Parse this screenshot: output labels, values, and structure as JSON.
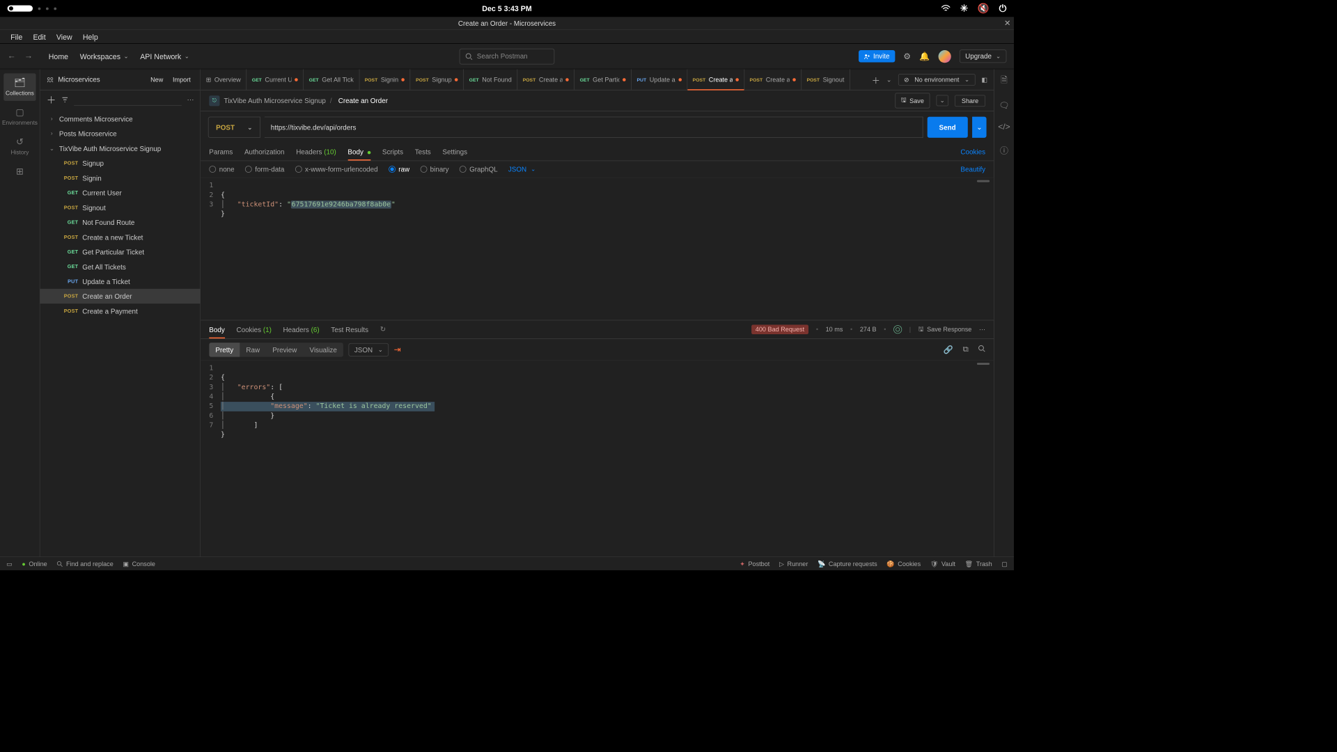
{
  "mac": {
    "clock": "Dec 5   3:43 PM"
  },
  "window": {
    "title": "Create an Order - Microservices"
  },
  "menu": {
    "file": "File",
    "edit": "Edit",
    "view": "View",
    "help": "Help"
  },
  "header": {
    "home": "Home",
    "workspaces": "Workspaces",
    "api_network": "API Network",
    "search_placeholder": "Search Postman",
    "invite": "Invite",
    "upgrade": "Upgrade"
  },
  "leftbar": {
    "collections": "Collections",
    "environments": "Environments",
    "history": "History"
  },
  "sidebar": {
    "title": "Microservices",
    "new": "New",
    "import": "Import",
    "folders": [
      {
        "name": "Comments Microservice",
        "open": false
      },
      {
        "name": "Posts Microservice",
        "open": false
      },
      {
        "name": "TixVibe Auth Microservice Signup",
        "open": true,
        "items": [
          {
            "method": "POST",
            "label": "Signup"
          },
          {
            "method": "POST",
            "label": "Signin"
          },
          {
            "method": "GET",
            "label": "Current User"
          },
          {
            "method": "POST",
            "label": "Signout"
          },
          {
            "method": "GET",
            "label": "Not Found Route"
          },
          {
            "method": "POST",
            "label": "Create a new Ticket"
          },
          {
            "method": "GET",
            "label": "Get Particular Ticket"
          },
          {
            "method": "GET",
            "label": "Get All Tickets"
          },
          {
            "method": "PUT",
            "label": "Update a Ticket"
          },
          {
            "method": "POST",
            "label": "Create an Order",
            "active": true
          },
          {
            "method": "POST",
            "label": "Create a Payment"
          }
        ]
      }
    ]
  },
  "tabs": [
    {
      "icon": "grid",
      "label": "Overview"
    },
    {
      "method": "GET",
      "label": "Current Us",
      "dirty": true
    },
    {
      "method": "GET",
      "label": "Get All Tick"
    },
    {
      "method": "POST",
      "label": "Signin",
      "dirty": true
    },
    {
      "method": "POST",
      "label": "Signup",
      "dirty": true
    },
    {
      "method": "GET",
      "label": "Not Found"
    },
    {
      "method": "POST",
      "label": "Create a",
      "dirty": true
    },
    {
      "method": "GET",
      "label": "Get Partic",
      "dirty": true
    },
    {
      "method": "PUT",
      "label": "Update a",
      "dirty": true
    },
    {
      "method": "POST",
      "label": "Create an",
      "dirty": true,
      "active": true
    },
    {
      "method": "POST",
      "label": "Create a",
      "dirty": true
    },
    {
      "method": "POST",
      "label": "Signout"
    }
  ],
  "env": {
    "label": "No environment"
  },
  "request": {
    "breadcrumb_workspace": "TixVibe Auth Microservice Signup",
    "title": "Create an Order",
    "save": "Save",
    "share": "Share",
    "method": "POST",
    "url": "https://tixvibe.dev/api/orders",
    "send": "Send"
  },
  "subtabs": {
    "params": "Params",
    "authorization": "Authorization",
    "headers_label": "Headers",
    "headers_count": "(10)",
    "body": "Body",
    "scripts": "Scripts",
    "tests": "Tests",
    "settings": "Settings",
    "cookies": "Cookies"
  },
  "bodytypes": {
    "none": "none",
    "formdata": "form-data",
    "xwww": "x-www-form-urlencoded",
    "raw": "raw",
    "binary": "binary",
    "graphql": "GraphQL",
    "json": "JSON",
    "beautify": "Beautify"
  },
  "body_code": {
    "l1": "{",
    "l2_key": "\"ticketId\"",
    "l2_sep": ": ",
    "l2_q1": "\"",
    "l2_val": "67517691e9246ba798f8ab0e",
    "l2_q2": "\"",
    "l3": "}"
  },
  "response": {
    "tabs": {
      "body": "Body",
      "cookies": "Cookies",
      "cookies_n": "(1)",
      "headers": "Headers",
      "headers_n": "(6)",
      "test_results": "Test Results"
    },
    "status": "400 Bad Request",
    "time": "10 ms",
    "size": "274 B",
    "save_response": "Save Response",
    "toolbar": {
      "pretty": "Pretty",
      "raw": "Raw",
      "preview": "Preview",
      "visualize": "Visualize",
      "json": "JSON"
    },
    "code": {
      "l1": "{",
      "l2_key": "\"errors\"",
      "l2_rest": ": [",
      "l3": "        {",
      "l4_key": "\"message\"",
      "l4_sep": ": ",
      "l4_val": "\"Ticket is already reserved\"",
      "l5": "        }",
      "l6": "    ]",
      "l7": "}"
    }
  },
  "status": {
    "online": "Online",
    "find": "Find and replace",
    "console": "Console",
    "postbot": "Postbot",
    "runner": "Runner",
    "capture": "Capture requests",
    "cookies": "Cookies",
    "vault": "Vault",
    "trash": "Trash"
  }
}
